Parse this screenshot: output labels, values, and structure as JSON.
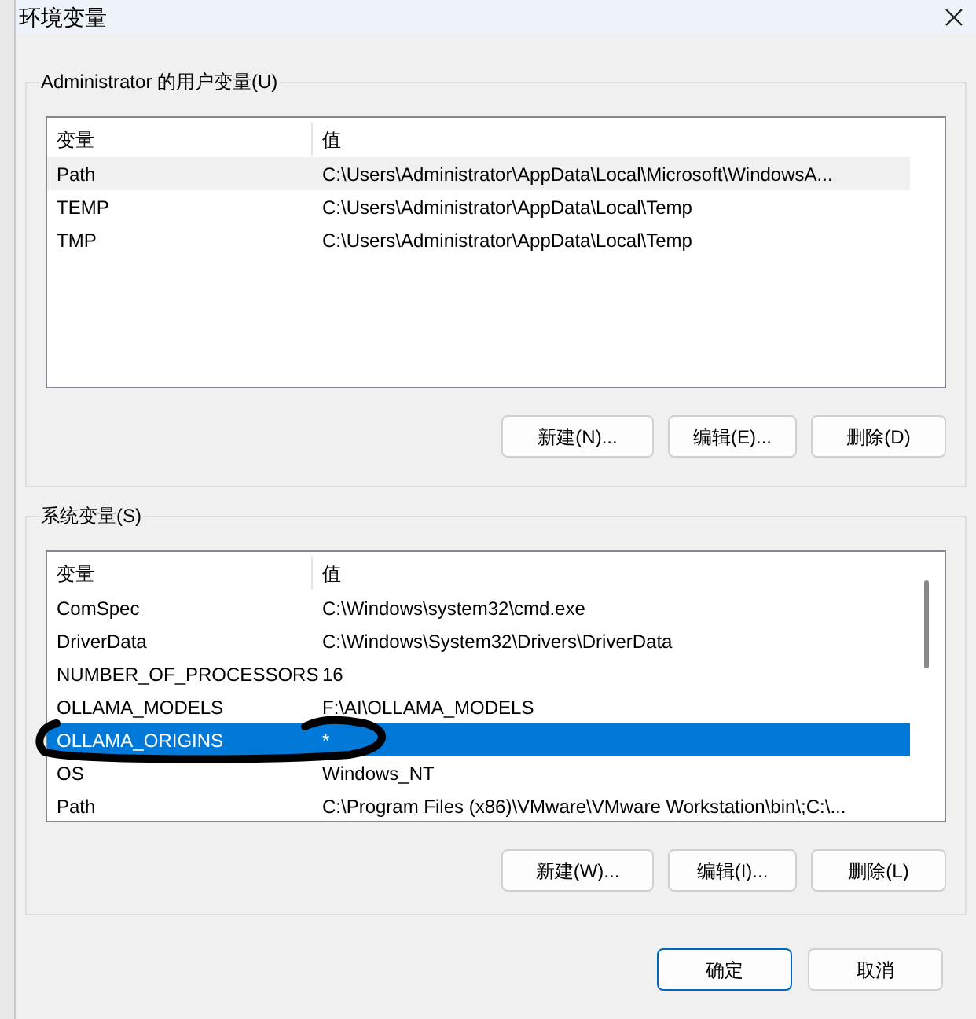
{
  "window": {
    "title": "环境变量"
  },
  "user_variables": {
    "label": "Administrator 的用户变量(U)",
    "columns": [
      "变量",
      "值"
    ],
    "rows": [
      {
        "name": "Path",
        "value": "C:\\Users\\Administrator\\AppData\\Local\\Microsoft\\WindowsA...",
        "selected": false,
        "hovered": true
      },
      {
        "name": "TEMP",
        "value": "C:\\Users\\Administrator\\AppData\\Local\\Temp",
        "selected": false,
        "hovered": false
      },
      {
        "name": "TMP",
        "value": "C:\\Users\\Administrator\\AppData\\Local\\Temp",
        "selected": false,
        "hovered": false
      }
    ],
    "buttons": [
      "新建(N)...",
      "编辑(E)...",
      "删除(D)"
    ]
  },
  "system_variables": {
    "label": "系统变量(S)",
    "columns": [
      "变量",
      "值"
    ],
    "rows": [
      {
        "name": "ComSpec",
        "value": "C:\\Windows\\system32\\cmd.exe",
        "selected": false,
        "hovered": false
      },
      {
        "name": "DriverData",
        "value": "C:\\Windows\\System32\\Drivers\\DriverData",
        "selected": false,
        "hovered": false
      },
      {
        "name": "NUMBER_OF_PROCESSORS",
        "value": "16",
        "selected": false,
        "hovered": false
      },
      {
        "name": "OLLAMA_MODELS",
        "value": "F:\\AI\\OLLAMA_MODELS",
        "selected": false,
        "hovered": false
      },
      {
        "name": "OLLAMA_ORIGINS",
        "value": "*",
        "selected": true,
        "hovered": false
      },
      {
        "name": "OS",
        "value": "Windows_NT",
        "selected": false,
        "hovered": false
      },
      {
        "name": "Path",
        "value": "C:\\Program Files (x86)\\VMware\\VMware Workstation\\bin\\;C:\\...",
        "selected": false,
        "hovered": false
      }
    ],
    "buttons": [
      "新建(W)...",
      "编辑(I)...",
      "删除(L)"
    ]
  },
  "footer_buttons": [
    {
      "label": "确定",
      "default": true
    },
    {
      "label": "取消",
      "default": false
    }
  ]
}
